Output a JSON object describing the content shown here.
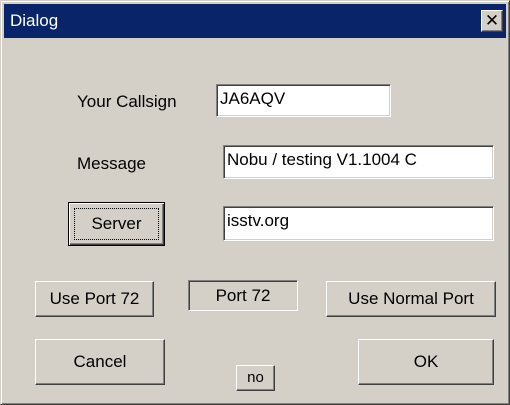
{
  "window": {
    "title": "Dialog",
    "close_glyph": "✕"
  },
  "form": {
    "callsign_label": "Your Callsign",
    "callsign_value": "JA6AQV",
    "message_label": "Message",
    "message_value": "Nobu / testing V1.1004 C",
    "server_button": "Server",
    "server_value": "isstv.org"
  },
  "ports": {
    "use_port_72_button": "Use Port 72",
    "port_status": "Port 72",
    "use_normal_port_button": "Use Normal Port"
  },
  "actions": {
    "cancel_button": "Cancel",
    "no_button": "no",
    "ok_button": "OK"
  },
  "colors": {
    "titlebar": "#0a246a",
    "face": "#d4d0c8"
  },
  "icons": {
    "close": "close-icon"
  }
}
